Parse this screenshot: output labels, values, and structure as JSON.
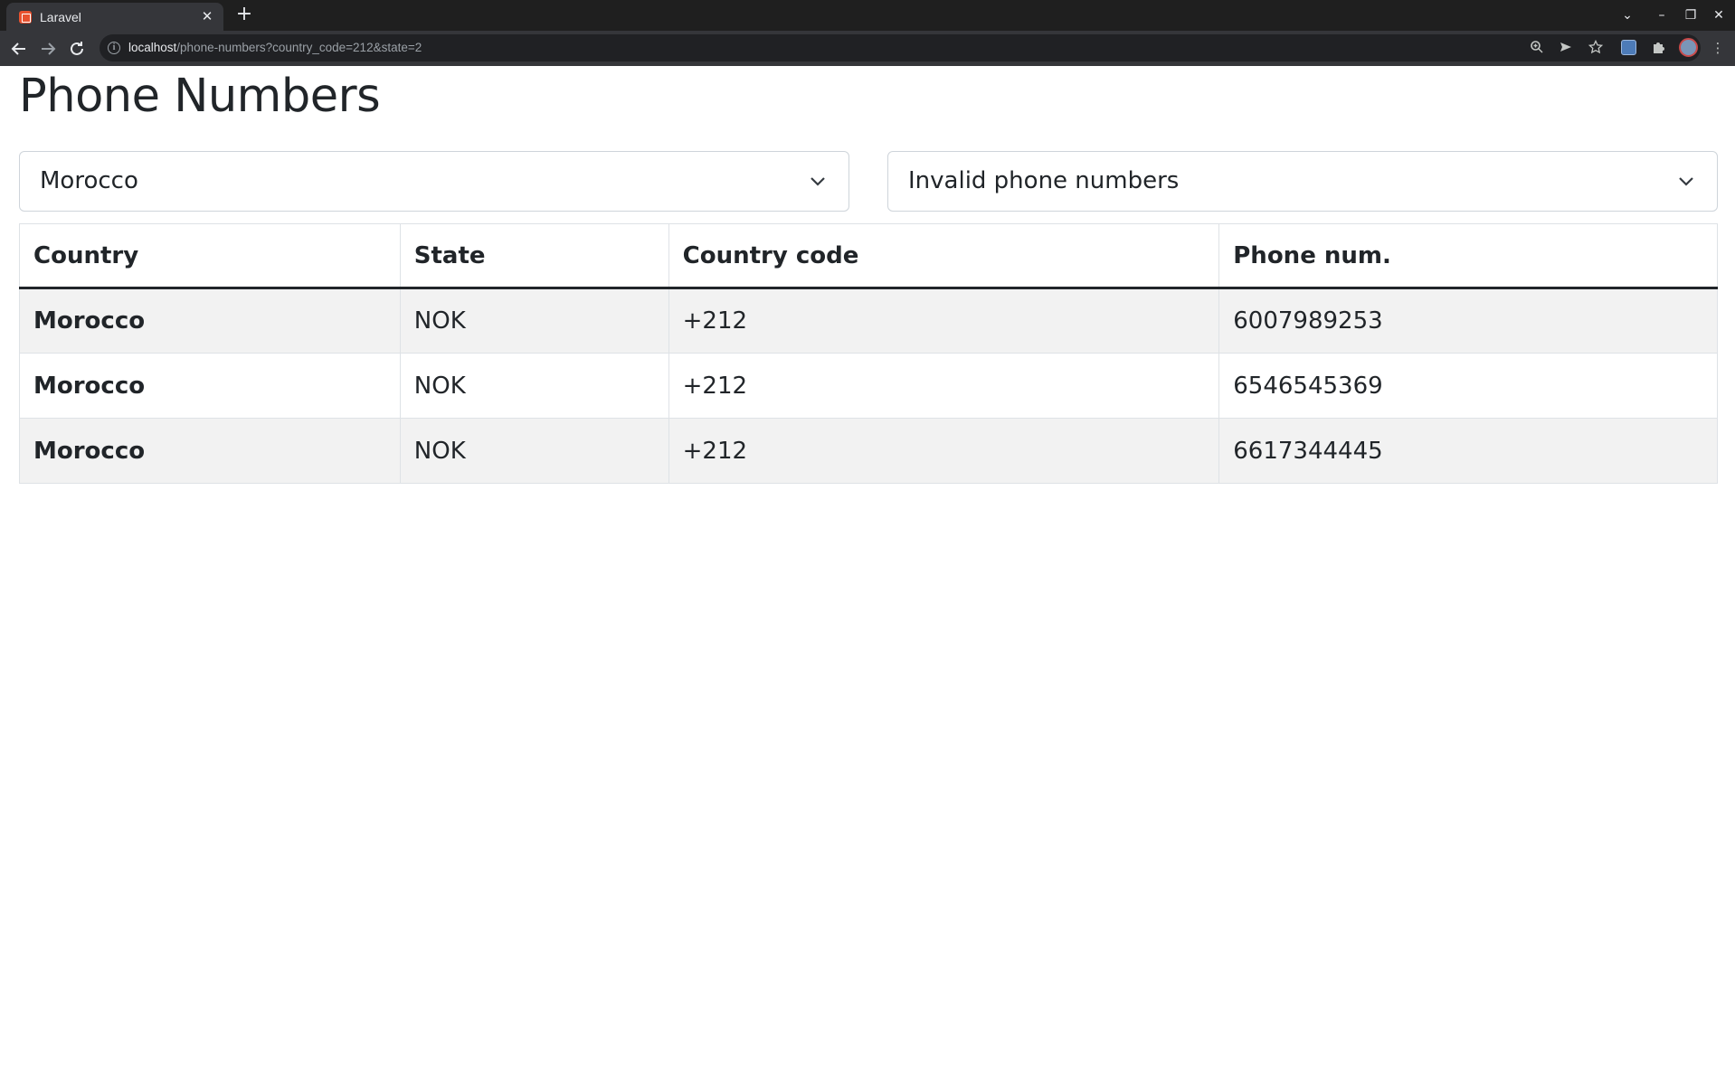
{
  "browser": {
    "tab_title": "Laravel",
    "tab_close": "✕",
    "new_tab": "+",
    "url_host": "localhost",
    "url_path": "/phone-numbers?country_code=212&state=2"
  },
  "icons": {
    "favicon": "laravel-favicon",
    "back": "arrow-left",
    "forward": "arrow-right",
    "reload": "reload",
    "site_info": "info",
    "zoom": "magnifier",
    "send": "send",
    "bookmark": "star",
    "extension": "extension",
    "puzzle": "puzzle",
    "profile": "avatar",
    "menu": "kebab"
  },
  "page": {
    "title": "Phone Numbers"
  },
  "filters": {
    "country": {
      "selected": "Morocco"
    },
    "state": {
      "selected": "Invalid phone numbers"
    }
  },
  "table": {
    "columns": [
      "Country",
      "State",
      "Country code",
      "Phone num."
    ],
    "rows": [
      {
        "country": "Morocco",
        "state": "NOK",
        "country_code": "+212",
        "phone": "6007989253"
      },
      {
        "country": "Morocco",
        "state": "NOK",
        "country_code": "+212",
        "phone": "6546545369"
      },
      {
        "country": "Morocco",
        "state": "NOK",
        "country_code": "+212",
        "phone": "6617344445"
      }
    ]
  },
  "colors": {
    "page_text": "#212529",
    "border": "#dee2e6",
    "stripe": "#f2f2f2",
    "chrome_dark": "#1f1f1f",
    "chrome_toolbar": "#35363a"
  }
}
